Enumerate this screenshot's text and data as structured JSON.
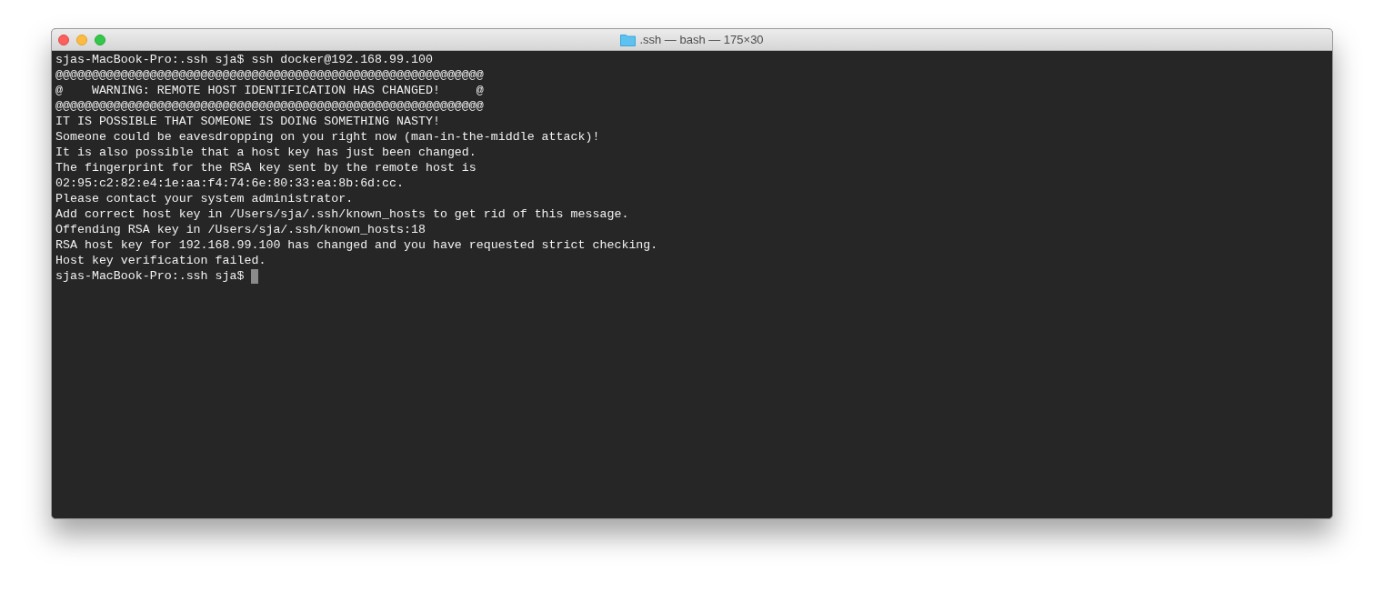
{
  "window": {
    "title": ".ssh — bash — 175×30"
  },
  "terminal": {
    "lines": [
      "sjas-MacBook-Pro:.ssh sja$ ssh docker@192.168.99.100",
      "@@@@@@@@@@@@@@@@@@@@@@@@@@@@@@@@@@@@@@@@@@@@@@@@@@@@@@@@@@@",
      "@    WARNING: REMOTE HOST IDENTIFICATION HAS CHANGED!     @",
      "@@@@@@@@@@@@@@@@@@@@@@@@@@@@@@@@@@@@@@@@@@@@@@@@@@@@@@@@@@@",
      "IT IS POSSIBLE THAT SOMEONE IS DOING SOMETHING NASTY!",
      "Someone could be eavesdropping on you right now (man-in-the-middle attack)!",
      "It is also possible that a host key has just been changed.",
      "The fingerprint for the RSA key sent by the remote host is",
      "02:95:c2:82:e4:1e:aa:f4:74:6e:80:33:ea:8b:6d:cc.",
      "Please contact your system administrator.",
      "Add correct host key in /Users/sja/.ssh/known_hosts to get rid of this message.",
      "Offending RSA key in /Users/sja/.ssh/known_hosts:18",
      "RSA host key for 192.168.99.100 has changed and you have requested strict checking.",
      "Host key verification failed."
    ],
    "prompt": "sjas-MacBook-Pro:.ssh sja$"
  }
}
